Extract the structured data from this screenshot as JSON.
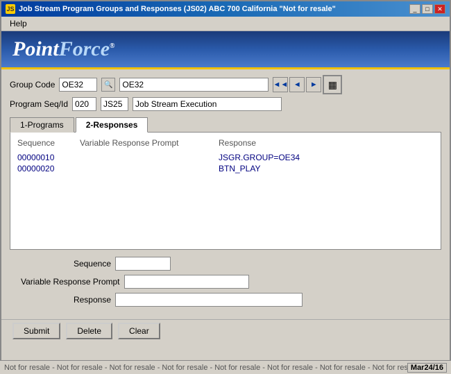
{
  "titleBar": {
    "title": "Job Stream Program Groups and Responses (JS02)   ABC 700    California \"Not for resale\"",
    "icon": "JS"
  },
  "menu": {
    "items": [
      "Help"
    ]
  },
  "logo": {
    "point": "Point",
    "force": "Force",
    "reg": "®"
  },
  "form": {
    "groupCodeLabel": "Group Code",
    "groupCodeValue": "OE32",
    "groupNameValue": "OE32",
    "programSeqLabel": "Program Seq/Id",
    "programSeqValue": "020",
    "programIdValue": "JS25",
    "programDescValue": "Job Stream Execution"
  },
  "tabs": [
    {
      "label": "1-Programs",
      "active": false
    },
    {
      "label": "2-Responses",
      "active": true
    }
  ],
  "table": {
    "headers": {
      "sequence": "Sequence",
      "vrp": "Variable Response Prompt",
      "response": "Response"
    },
    "rows": [
      {
        "sequence": "00000010",
        "vrp": "",
        "response": "JSGR.GROUP=OE34"
      },
      {
        "sequence": "00000020",
        "vrp": "",
        "response": "BTN_PLAY"
      }
    ]
  },
  "fields": {
    "sequenceLabel": "Sequence",
    "vrpLabel": "Variable Response Prompt",
    "responseLabel": "Response",
    "sequenceValue": "",
    "vrpValue": "",
    "responseValue": ""
  },
  "buttons": {
    "submit": "Submit",
    "delete": "Delete",
    "clear": "Clear"
  },
  "statusBar": {
    "text": "Not for resale - Not for resale - Not for resale - Not for resale - Not for resale - Not for resale - Not for resale - Not for resale - N",
    "date": "Mar24/16"
  },
  "navIcons": {
    "first": "◄◄",
    "prev": "◄",
    "next": "►",
    "calc": "▦"
  }
}
